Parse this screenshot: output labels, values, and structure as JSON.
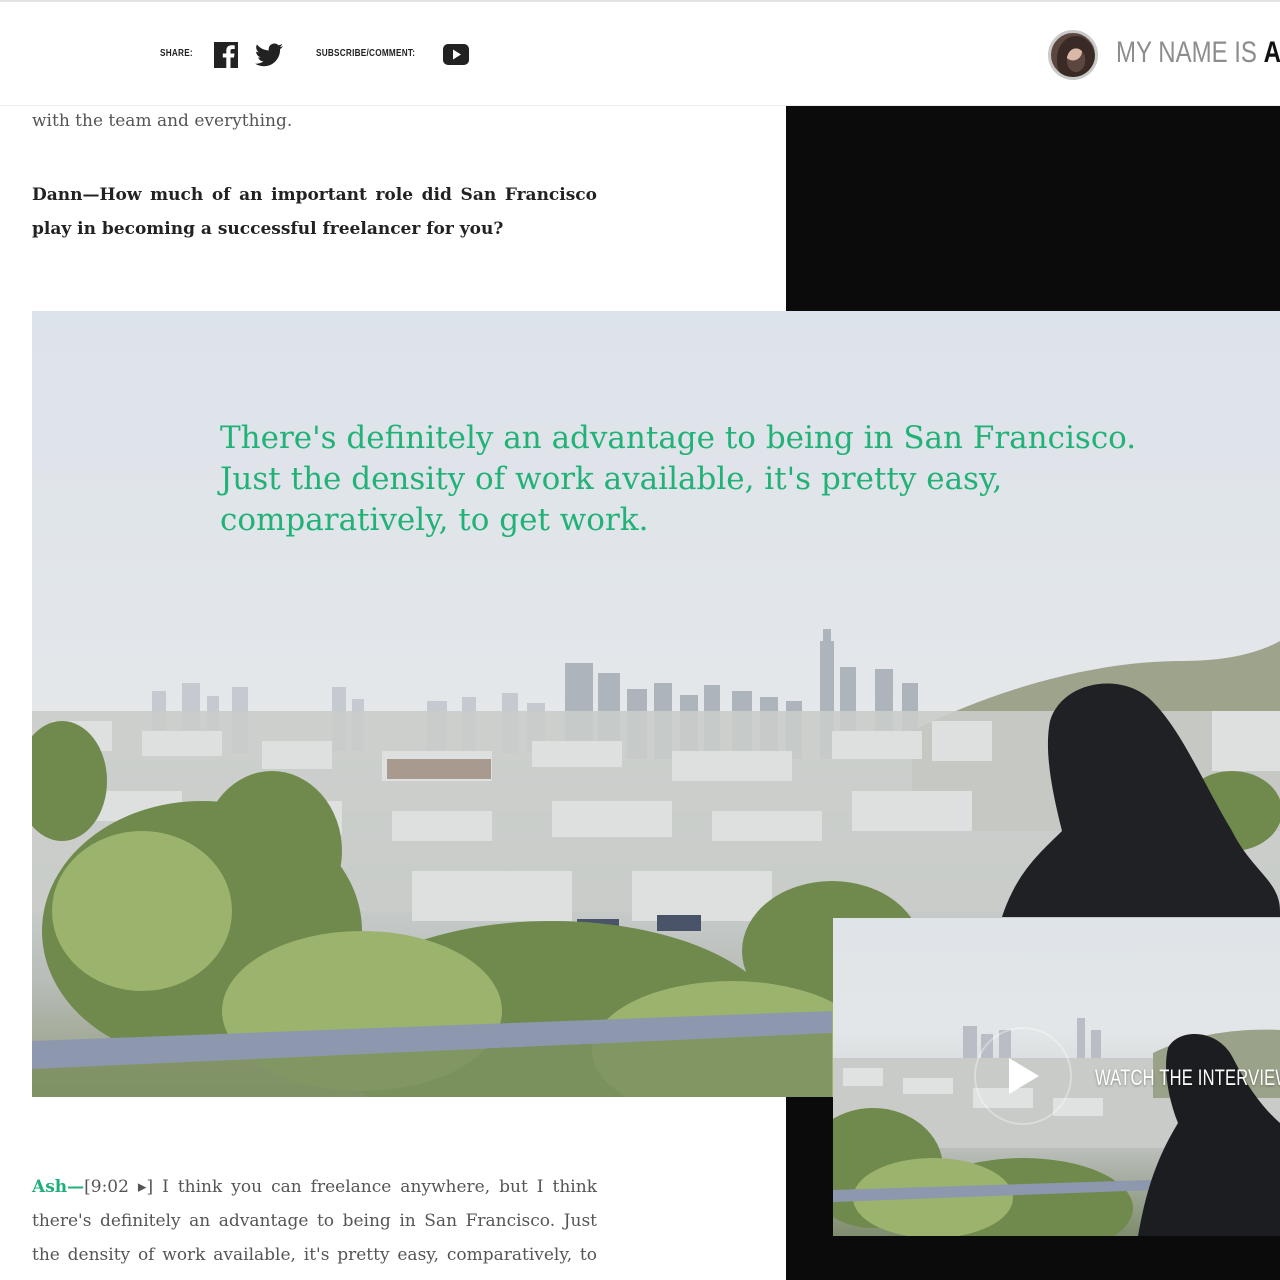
{
  "header": {
    "share_label": "SHARE:",
    "subscribe_label": "SUBSCRIBE/COMMENT:",
    "site_name_prefix": "MY NAME IS",
    "site_name_bold": "ASH",
    "icons": [
      "facebook-icon",
      "twitter-icon",
      "youtube-icon"
    ]
  },
  "article": {
    "intro_tail": "with the team and everything.",
    "question": "Dann—How much of an important role did San Francisco play in becoming a successful freelancer for you?",
    "pull_quote": "There's definitely an advantage to being in San Francisco. Just the density of work available, it's pretty easy, comparatively, to get work.",
    "answer_speaker": "Ash—",
    "answer_timestamp": "[9:02 ▸]",
    "answer_text": " I think you can freelance anywhere, but I think there's definitely an advantage to being in San Francisco. Just the density of work available, it's pretty easy, comparatively, to get"
  },
  "video": {
    "label": "WATCH THE INTERVIEW"
  },
  "colors": {
    "accent_green": "#1db07a",
    "black_column": "#0b0b0b"
  }
}
